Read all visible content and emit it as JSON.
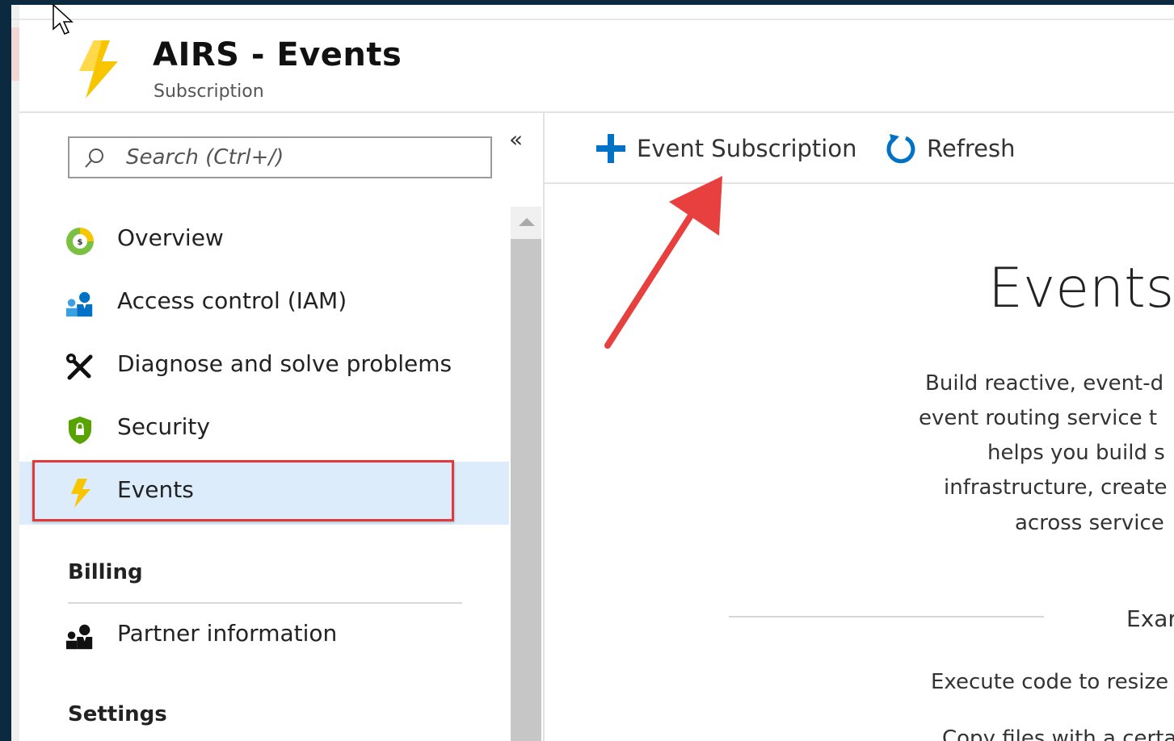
{
  "blade": {
    "title": "AIRS - Events",
    "subtitle": "Subscription",
    "collapse_glyph": "«"
  },
  "search": {
    "placeholder": "Search (Ctrl+/)",
    "icon": "search-icon"
  },
  "sidebar": {
    "items": [
      {
        "label": "Overview",
        "icon": "overview-icon"
      },
      {
        "label": "Access control (IAM)",
        "icon": "people-icon"
      },
      {
        "label": "Diagnose and solve problems",
        "icon": "wrench-icon"
      },
      {
        "label": "Security",
        "icon": "shield-icon"
      },
      {
        "label": "Events",
        "icon": "lightning-icon",
        "active": true
      }
    ],
    "sections": [
      {
        "heading": "Billing",
        "items": [
          {
            "label": "Partner information",
            "icon": "people-icon"
          }
        ]
      },
      {
        "heading": "Settings",
        "items": []
      }
    ]
  },
  "toolbar": {
    "add_label": "Event Subscription",
    "refresh_label": "Refresh"
  },
  "main": {
    "heading": "Events,",
    "description_lines": [
      "Build reactive, event-d",
      "event routing service t",
      "helps you build s",
      "infrastructure, create",
      "across service"
    ],
    "examples_heading": "Exar",
    "example_lines": [
      "Execute code to resize a",
      "Copy files with a certai"
    ]
  },
  "colors": {
    "accent_blue": "#0072c6",
    "active_row": "#dcecfb",
    "highlight_red": "#e03a3a",
    "bolt_yellow": "#f7c600"
  }
}
